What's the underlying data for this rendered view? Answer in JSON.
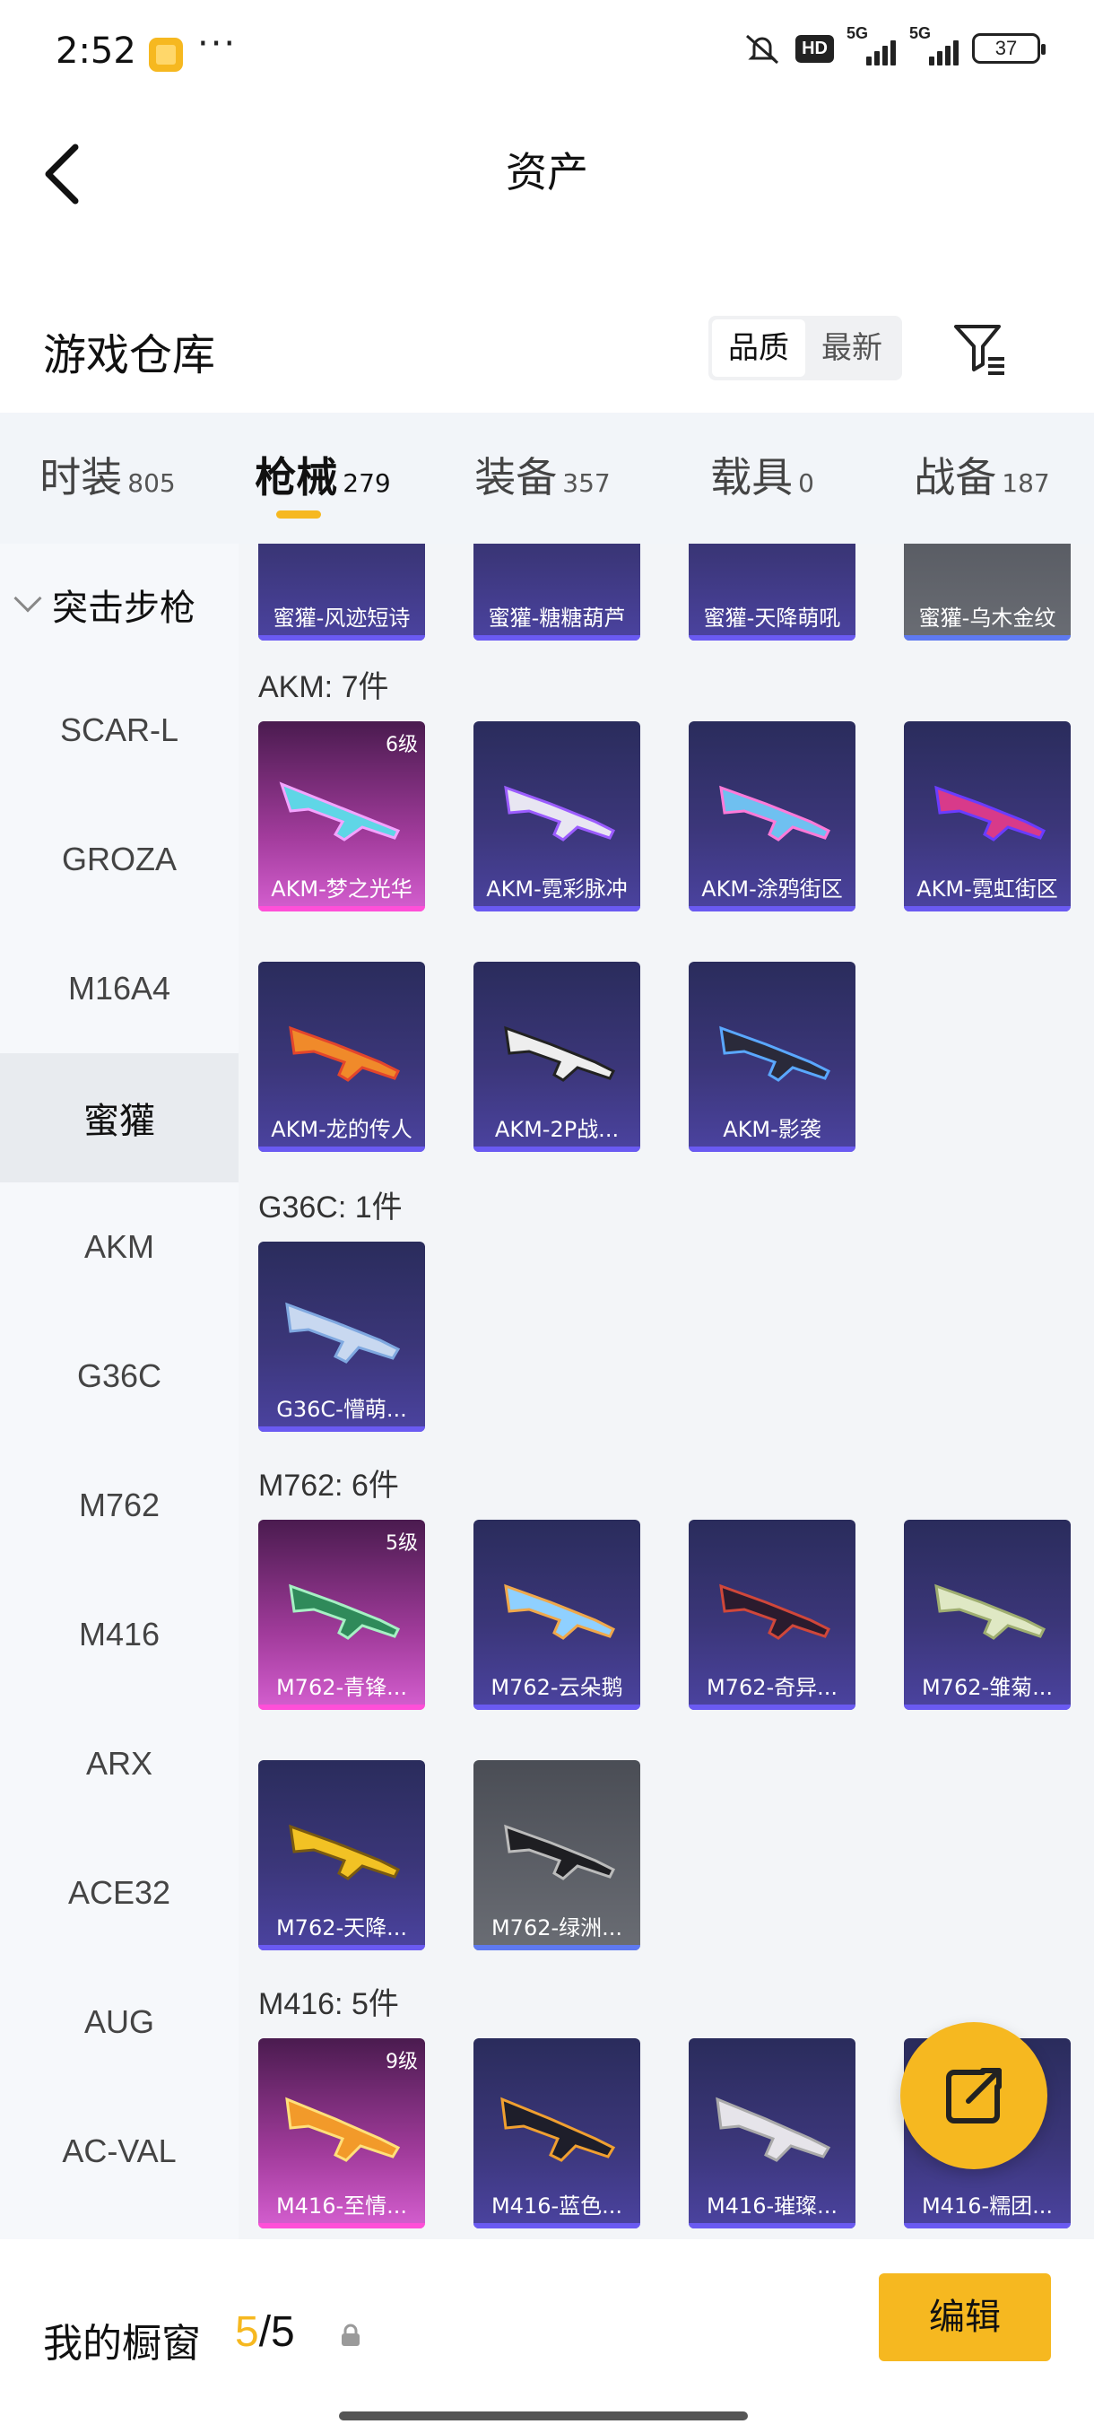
{
  "status_bar": {
    "time": "2:52",
    "dots": "···",
    "hd": "HD",
    "signal1": "5G",
    "signal2": "5G",
    "battery": "37"
  },
  "nav": {
    "title": "资产"
  },
  "warehouse": {
    "title": "游戏仓库",
    "sort_options": [
      "品质",
      "最新"
    ],
    "active_sort": "品质"
  },
  "tabs": [
    {
      "label": "时装",
      "count": "805"
    },
    {
      "label": "枪械",
      "count": "279",
      "active": true
    },
    {
      "label": "装备",
      "count": "357"
    },
    {
      "label": "载具",
      "count": "0"
    },
    {
      "label": "战备",
      "count": "187"
    }
  ],
  "sidebar": {
    "header": "突击步枪",
    "items": [
      "SCAR-L",
      "GROZA",
      "M16A4",
      "蜜獾",
      "AKM",
      "G36C",
      "M762",
      "M416",
      "ARX",
      "ACE32",
      "AUG",
      "AC-VAL"
    ],
    "selected": "蜜獾"
  },
  "groups": {
    "honey_partial": [
      "蜜獾-风迹短诗",
      "蜜獾-糖糖葫芦",
      "蜜獾-天降萌吼",
      "蜜獾-乌木金纹"
    ],
    "akm": {
      "label": "AKM: 7件",
      "items": [
        {
          "name": "AKM-梦之光华",
          "level": "6级"
        },
        {
          "name": "AKM-霓彩脉冲"
        },
        {
          "name": "AKM-涂鸦街区"
        },
        {
          "name": "AKM-霓虹街区"
        },
        {
          "name": "AKM-龙的传人"
        },
        {
          "name": "AKM-2P战..."
        },
        {
          "name": "AKM-影袭"
        }
      ]
    },
    "g36c": {
      "label": "G36C: 1件",
      "items": [
        {
          "name": "G36C-懵萌..."
        }
      ]
    },
    "m762": {
      "label": "M762: 6件",
      "items": [
        {
          "name": "M762-青锋...",
          "level": "5级"
        },
        {
          "name": "M762-云朵鹅"
        },
        {
          "name": "M762-奇异..."
        },
        {
          "name": "M762-雏菊..."
        },
        {
          "name": "M762-天降..."
        },
        {
          "name": "M762-绿洲..."
        }
      ]
    },
    "m416": {
      "label": "M416: 5件",
      "items": [
        {
          "name": "M416-至情...",
          "level": "9级"
        },
        {
          "name": "M416-蓝色..."
        },
        {
          "name": "M416-璀璨..."
        },
        {
          "name": "M416-糯团..."
        }
      ]
    }
  },
  "bottom": {
    "showcase_label": "我的橱窗",
    "showcase_current": "5",
    "showcase_total": "/5",
    "edit_label": "编辑"
  },
  "colors": {
    "accent": "#f6b820",
    "card_blue": "#3b3679",
    "card_gold": "#a13b9b"
  }
}
